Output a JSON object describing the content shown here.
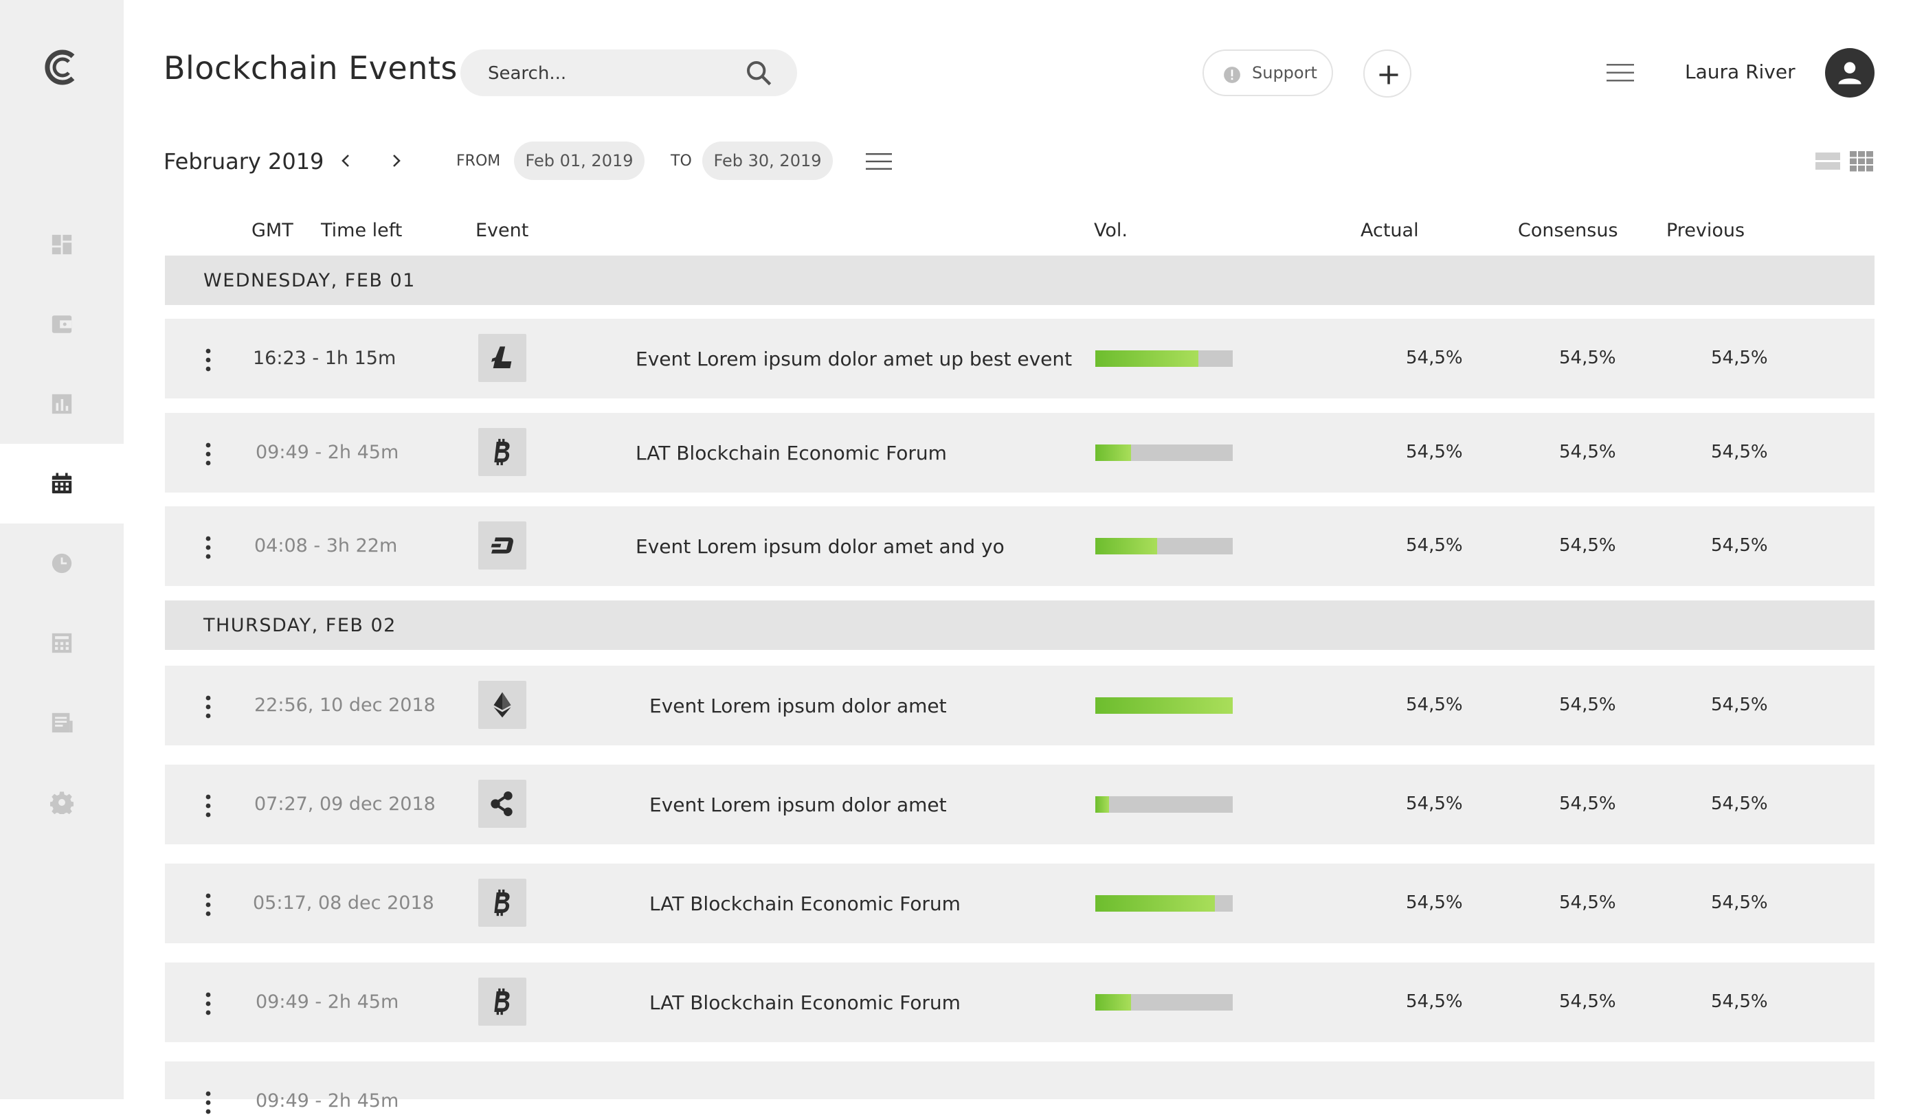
{
  "app": {
    "title": "Blockchain Events"
  },
  "search": {
    "placeholder": "Search..."
  },
  "header": {
    "support_label": "Support",
    "user_name": "Laura River"
  },
  "filters": {
    "month": "February 2019",
    "from_label": "FROM",
    "from_value": "Feb 01, 2019",
    "to_label": "TO",
    "to_value": "Feb 30, 2019"
  },
  "sidebar": {
    "items": [
      {
        "icon": "dashboard-icon",
        "active": false
      },
      {
        "icon": "wallet-icon",
        "active": false
      },
      {
        "icon": "bar-chart-icon",
        "active": false
      },
      {
        "icon": "calendar-icon",
        "active": true
      },
      {
        "icon": "clock-icon",
        "active": false
      },
      {
        "icon": "calculator-icon",
        "active": false
      },
      {
        "icon": "news-icon",
        "active": false
      },
      {
        "icon": "gear-icon",
        "active": false
      }
    ]
  },
  "table": {
    "columns": {
      "gmt": "GMT",
      "time_left": "Time left",
      "event": "Event",
      "vol": "Vol.",
      "actual": "Actual",
      "consensus": "Consensus",
      "previous": "Previous"
    },
    "groups": [
      {
        "day": "WEDNESDAY, FEB 01",
        "rows": [
          {
            "time": "16:23 - 1h 15m",
            "coin": "litecoin-icon",
            "event": "Event Lorem ipsum dolor amet up best event",
            "volume": 0.75,
            "actual": "54,5%",
            "consensus": "54,5%",
            "previous": "54,5%"
          },
          {
            "time": "09:49 - 2h 45m",
            "coin": "bitcoin-icon",
            "event": "LAT Blockchain Economic Forum",
            "volume": 0.26,
            "actual": "54,5%",
            "consensus": "54,5%",
            "previous": "54,5%"
          },
          {
            "time": "04:08 - 3h 22m",
            "coin": "dash-icon",
            "event": "Event Lorem ipsum dolor amet and yo",
            "volume": 0.45,
            "actual": "54,5%",
            "consensus": "54,5%",
            "previous": "54,5%"
          }
        ]
      },
      {
        "day": "THURSDAY, FEB 02",
        "rows": [
          {
            "time": "22:56, 10 dec 2018",
            "coin": "ethereum-icon",
            "event": "Event Lorem ipsum dolor amet",
            "volume": 1.0,
            "actual": "54,5%",
            "consensus": "54,5%",
            "previous": "54,5%"
          },
          {
            "time": "07:27, 09 dec 2018",
            "coin": "ripple-icon",
            "event": "Event Lorem ipsum dolor amet",
            "volume": 0.1,
            "actual": "54,5%",
            "consensus": "54,5%",
            "previous": "54,5%"
          },
          {
            "time": "05:17, 08 dec 2018",
            "coin": "bitcoin-icon",
            "event": "LAT Blockchain Economic Forum",
            "volume": 0.87,
            "actual": "54,5%",
            "consensus": "54,5%",
            "previous": "54,5%"
          },
          {
            "time": "09:49 - 2h 45m",
            "coin": "bitcoin-icon",
            "event": "LAT Blockchain Economic Forum",
            "volume": 0.26,
            "actual": "54,5%",
            "consensus": "54,5%",
            "previous": "54,5%"
          },
          {
            "time": "09:49 - 2h 45m",
            "coin": "",
            "event": "",
            "volume": null,
            "actual": "",
            "consensus": "",
            "previous": ""
          }
        ]
      }
    ]
  },
  "colors": {
    "sidebar_bg": "#efefef",
    "row_bg": "#efefef",
    "day_header_bg": "#e4e4e4",
    "volume_fill": "#7cc43a",
    "volume_track": "#c9c9c9",
    "icon_muted": "#c6c6c6"
  }
}
